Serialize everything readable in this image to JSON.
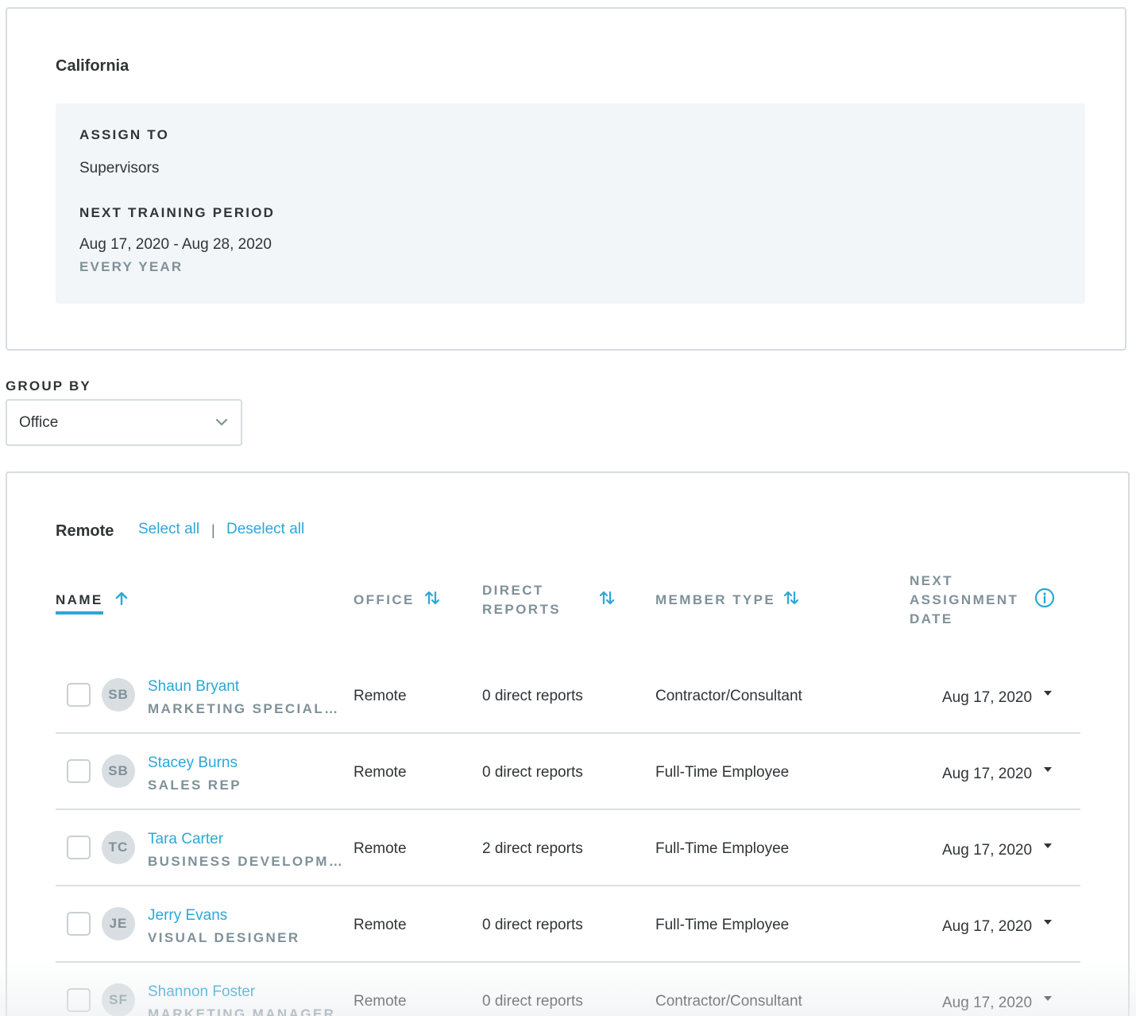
{
  "policy": {
    "title": "California",
    "assign_to_label": "ASSIGN TO",
    "assign_to_value": "Supervisors",
    "period_label": "NEXT TRAINING PERIOD",
    "period_value": "Aug 17, 2020 - Aug 28, 2020",
    "recurrence": "EVERY YEAR"
  },
  "group_by": {
    "label": "GROUP BY",
    "selected": "Office"
  },
  "group": {
    "title": "Remote",
    "select_all": "Select all",
    "separator": "|",
    "deselect_all": "Deselect all"
  },
  "table": {
    "headers": {
      "name": "NAME",
      "office": "OFFICE",
      "direct_reports": "DIRECT REPORTS",
      "member_type": "MEMBER TYPE",
      "next_assignment_date": "NEXT ASSIGNMENT DATE"
    },
    "rows": [
      {
        "initials": "SB",
        "name": "Shaun Bryant",
        "role": "MARKETING SPECIALIST",
        "office": "Remote",
        "direct_reports": "0 direct reports",
        "member_type": "Contractor/Consultant",
        "date": "Aug 17, 2020"
      },
      {
        "initials": "SB",
        "name": "Stacey Burns",
        "role": "SALES REP",
        "office": "Remote",
        "direct_reports": "0 direct reports",
        "member_type": "Full-Time Employee",
        "date": "Aug 17, 2020"
      },
      {
        "initials": "TC",
        "name": "Tara Carter",
        "role": "BUSINESS DEVELOPMENT",
        "office": "Remote",
        "direct_reports": "2 direct reports",
        "member_type": "Full-Time Employee",
        "date": "Aug 17, 2020"
      },
      {
        "initials": "JE",
        "name": "Jerry Evans",
        "role": "VISUAL DESIGNER",
        "office": "Remote",
        "direct_reports": "0 direct reports",
        "member_type": "Full-Time Employee",
        "date": "Aug 17, 2020"
      },
      {
        "initials": "SF",
        "name": "Shannon Foster",
        "role": "MARKETING MANAGER",
        "office": "Remote",
        "direct_reports": "0 direct reports",
        "member_type": "Contractor/Consultant",
        "date": "Aug 17, 2020"
      }
    ]
  },
  "colors": {
    "accent": "#2ca7d8",
    "muted": "#7f9199",
    "border": "#d6dde0"
  },
  "icons": {
    "sort_ascending": "arrow-up-icon",
    "sort_both": "sort-arrows-icon",
    "info": "info-circle-icon",
    "dropdown": "chevron-down-icon",
    "row_caret": "caret-down-icon"
  }
}
